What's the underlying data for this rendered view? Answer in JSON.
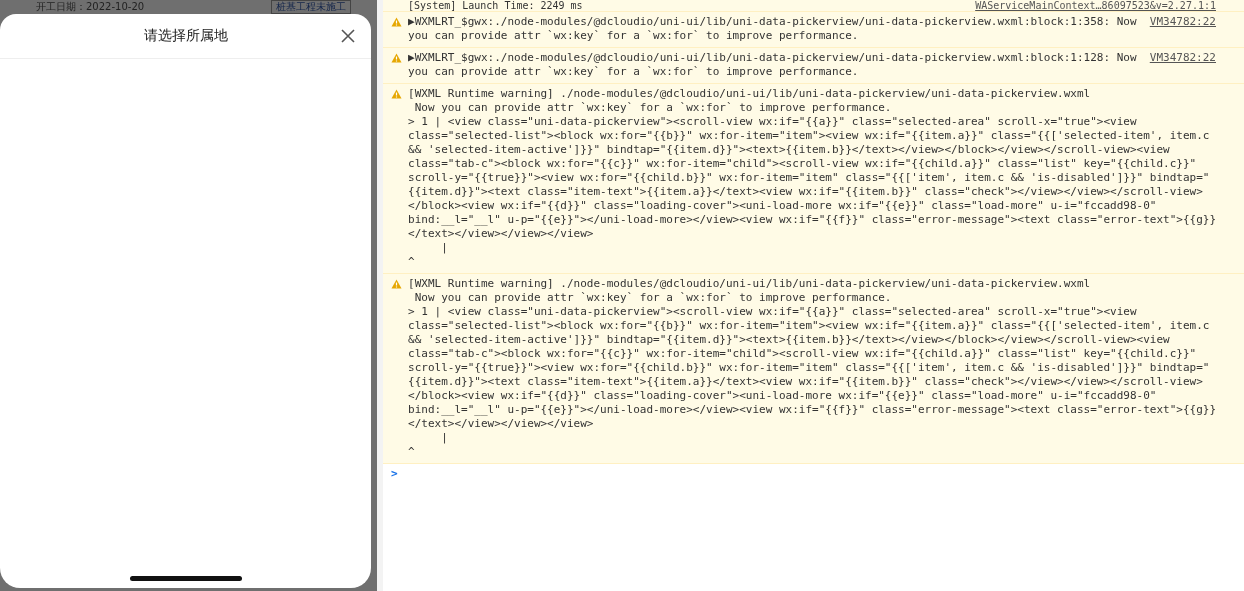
{
  "background": {
    "date_label": "开工日期：2022-10-20",
    "status_button": "桩基工程未施工"
  },
  "sheet": {
    "title": "请选择所属地"
  },
  "console": {
    "top_line": {
      "message": "[System] Launch Time: 2249 ms",
      "source": "WAServiceMainContext…86097523&v=2.27.1:1"
    },
    "messages": [
      {
        "kind": "warning",
        "source": "VM34782:22",
        "lines": [
          "▶WXMLRT_$gwx:./node-modules/@dcloudio/uni-ui/lib/uni-data-pickerview/uni-data-pickerview.wxml:block:1:358: Now",
          "you can provide attr `wx:key` for a `wx:for` to improve performance."
        ]
      },
      {
        "kind": "warning",
        "source": "VM34782:22",
        "lines": [
          "▶WXMLRT_$gwx:./node-modules/@dcloudio/uni-ui/lib/uni-data-pickerview/uni-data-pickerview.wxml:block:1:128: Now",
          "you can provide attr `wx:key` for a `wx:for` to improve performance."
        ]
      },
      {
        "kind": "warning",
        "lines": [
          "[WXML Runtime warning] ./node-modules/@dcloudio/uni-ui/lib/uni-data-pickerview/uni-data-pickerview.wxml",
          " Now you can provide attr `wx:key` for a `wx:for` to improve performance.",
          "> 1 | <view class=\"uni-data-pickerview\"><scroll-view wx:if=\"{{a}}\" class=\"selected-area\" scroll-x=\"true\"><view",
          "class=\"selected-list\"><block wx:for=\"{{b}}\" wx:for-item=\"item\"><view wx:if=\"{{item.a}}\" class=\"{{['selected-item', item.c",
          "&& 'selected-item-active']}}\" bindtap=\"{{item.d}}\"><text>{{item.b}}</text></view></block></view></scroll-view><view",
          "class=\"tab-c\"><block wx:for=\"{{c}}\" wx:for-item=\"child\"><scroll-view wx:if=\"{{child.a}}\" class=\"list\" key=\"{{child.c}}\"",
          "scroll-y=\"{{true}}\"><view wx:for=\"{{child.b}}\" wx:for-item=\"item\" class=\"{{['item', item.c && 'is-disabled']}}\" bindtap=\"",
          "{{item.d}}\"><text class=\"item-text\">{{item.a}}</text><view wx:if=\"{{item.b}}\" class=\"check\"></view></view></scroll-view>",
          "</block><view wx:if=\"{{d}}\" class=\"loading-cover\"><uni-load-more wx:if=\"{{e}}\" class=\"load-more\" u-i=\"fccadd98-0\"",
          "bind:__l=\"__l\" u-p=\"{{e}}\"></uni-load-more></view><view wx:if=\"{{f}}\" class=\"error-message\"><text class=\"error-text\">{{g}}",
          "</text></view></view></view>",
          "     |",
          "^"
        ]
      },
      {
        "kind": "warning",
        "lines": [
          "[WXML Runtime warning] ./node-modules/@dcloudio/uni-ui/lib/uni-data-pickerview/uni-data-pickerview.wxml",
          " Now you can provide attr `wx:key` for a `wx:for` to improve performance.",
          "> 1 | <view class=\"uni-data-pickerview\"><scroll-view wx:if=\"{{a}}\" class=\"selected-area\" scroll-x=\"true\"><view",
          "class=\"selected-list\"><block wx:for=\"{{b}}\" wx:for-item=\"item\"><view wx:if=\"{{item.a}}\" class=\"{{['selected-item', item.c",
          "&& 'selected-item-active']}}\" bindtap=\"{{item.d}}\"><text>{{item.b}}</text></view></block></view></scroll-view><view",
          "class=\"tab-c\"><block wx:for=\"{{c}}\" wx:for-item=\"child\"><scroll-view wx:if=\"{{child.a}}\" class=\"list\" key=\"{{child.c}}\"",
          "scroll-y=\"{{true}}\"><view wx:for=\"{{child.b}}\" wx:for-item=\"item\" class=\"{{['item', item.c && 'is-disabled']}}\" bindtap=\"",
          "{{item.d}}\"><text class=\"item-text\">{{item.a}}</text><view wx:if=\"{{item.b}}\" class=\"check\"></view></view></scroll-view>",
          "</block><view wx:if=\"{{d}}\" class=\"loading-cover\"><uni-load-more wx:if=\"{{e}}\" class=\"load-more\" u-i=\"fccadd98-0\"",
          "bind:__l=\"__l\" u-p=\"{{e}}\"></uni-load-more></view><view wx:if=\"{{f}}\" class=\"error-message\"><text class=\"error-text\">{{g}}",
          "</text></view></view></view>",
          "     |",
          "^"
        ]
      }
    ],
    "prompt": ">"
  }
}
